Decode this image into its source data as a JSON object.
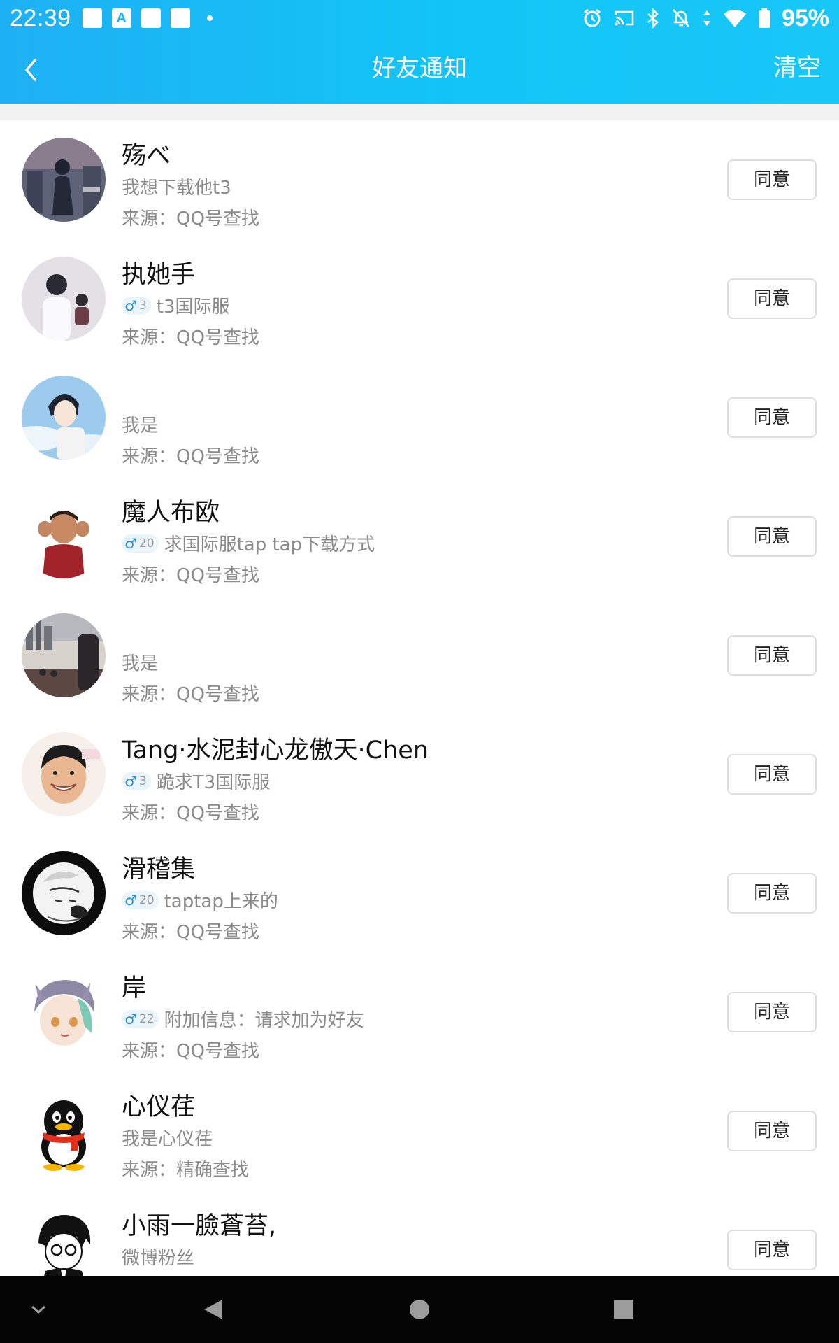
{
  "status_bar": {
    "time": "22:39",
    "notif_a_label": "A",
    "battery": "95%"
  },
  "header": {
    "title": "好友通知",
    "clear_label": "清空"
  },
  "colors": {
    "header_start": "#1EB0F4",
    "header_end": "#18C7F8",
    "secondary_text": "#8B8B8B",
    "male_badge": "#2C8FD6"
  },
  "requests": [
    {
      "name": "殇べ",
      "gender": "",
      "age": "",
      "message": "我想下载他t3",
      "source": "来源：QQ号查找",
      "action": "同意"
    },
    {
      "name": "执她手",
      "gender": "♂",
      "age": "3",
      "message": "t3国际服",
      "source": "来源：QQ号查找",
      "action": "同意"
    },
    {
      "name": "",
      "gender": "",
      "age": "",
      "message": "我是",
      "source": "来源：QQ号查找",
      "action": "同意"
    },
    {
      "name": "魔人布欧",
      "gender": "♂",
      "age": "20",
      "message": "求国际服tap tap下载方式",
      "source": "来源：QQ号查找",
      "action": "同意"
    },
    {
      "name": "",
      "gender": "",
      "age": "",
      "message": "我是",
      "source": "来源：QQ号查找",
      "action": "同意"
    },
    {
      "name": "Tang·水泥封心龙傲天·Chen",
      "gender": "♂",
      "age": "3",
      "message": "跪求T3国际服",
      "source": "来源：QQ号查找",
      "action": "同意"
    },
    {
      "name": "滑稽集",
      "gender": "♂",
      "age": "20",
      "message": "taptap上来的",
      "source": "来源：QQ号查找",
      "action": "同意"
    },
    {
      "name": "岸",
      "gender": "♂",
      "age": "22",
      "message": "附加信息：请求加为好友",
      "source": "来源：QQ号查找",
      "action": "同意"
    },
    {
      "name": "心仪荏",
      "gender": "",
      "age": "",
      "message": "我是心仪荏",
      "source": "来源：精确查找",
      "action": "同意"
    },
    {
      "name": "小雨一臉蒼苔,",
      "gender": "",
      "age": "",
      "message": "微博粉丝",
      "source": "",
      "action": "同意"
    }
  ]
}
